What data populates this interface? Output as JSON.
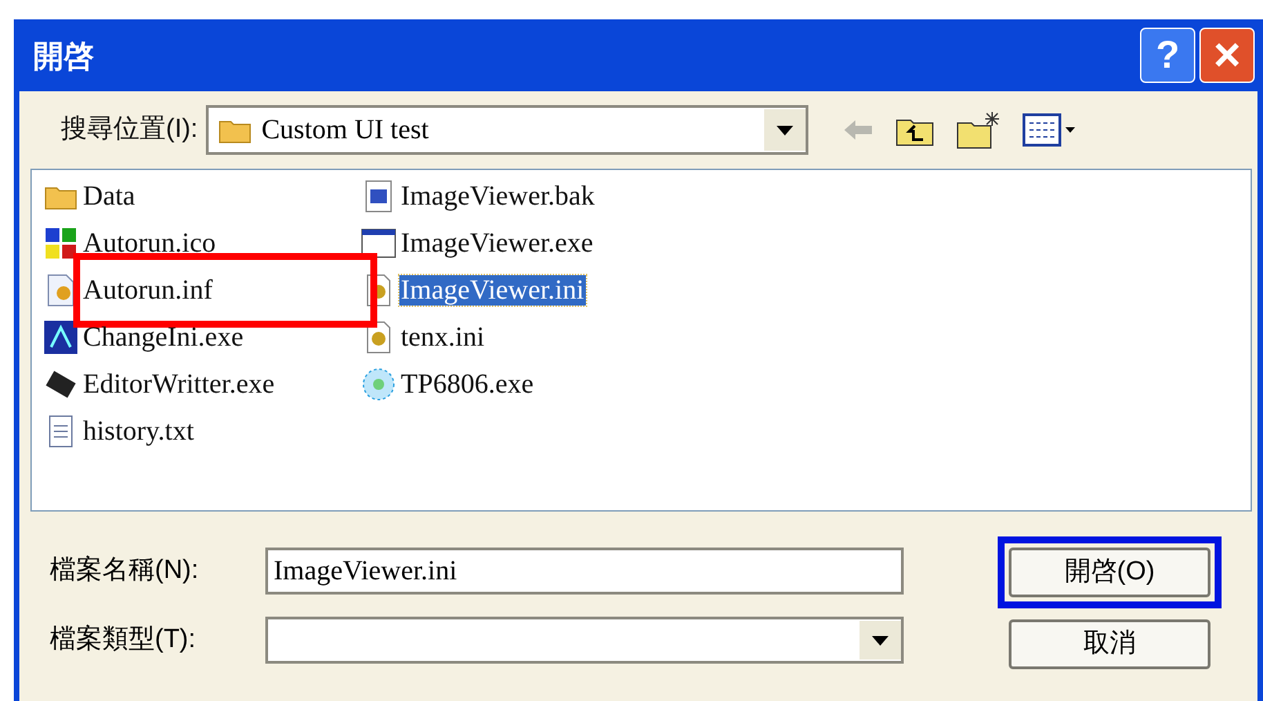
{
  "window": {
    "title": "開啓",
    "help": "?",
    "close": "×"
  },
  "toolbar": {
    "label": "搜尋位置(I):",
    "location": "Custom UI test"
  },
  "files": [
    {
      "name": "Data",
      "kind": "folder",
      "selected": false,
      "annotated": false
    },
    {
      "name": "Autorun.ico",
      "kind": "tiles",
      "selected": false,
      "annotated": false
    },
    {
      "name": "Autorun.inf",
      "kind": "setup",
      "selected": false,
      "annotated": true
    },
    {
      "name": "ChangeIni.exe",
      "kind": "network",
      "selected": false,
      "annotated": false
    },
    {
      "name": "EditorWritter.exe",
      "kind": "chip",
      "selected": false,
      "annotated": false
    },
    {
      "name": "history.txt",
      "kind": "text",
      "selected": false,
      "annotated": false
    },
    {
      "name": "ImageViewer.bak",
      "kind": "backup",
      "selected": false,
      "annotated": false
    },
    {
      "name": "ImageViewer.exe",
      "kind": "window",
      "selected": false,
      "annotated": false
    },
    {
      "name": "ImageViewer.ini",
      "kind": "gear",
      "selected": true,
      "annotated": false
    },
    {
      "name": "tenx.ini",
      "kind": "gear",
      "selected": false,
      "annotated": false
    },
    {
      "name": "TP6806.exe",
      "kind": "disc",
      "selected": false,
      "annotated": false
    }
  ],
  "filename": {
    "label": "檔案名稱(N):",
    "value": "ImageViewer.ini"
  },
  "filetype": {
    "label": "檔案類型(T):"
  },
  "buttons": [
    {
      "label": "開啓(O)",
      "annotated": true
    },
    {
      "label": "取消",
      "annotated": false
    }
  ]
}
